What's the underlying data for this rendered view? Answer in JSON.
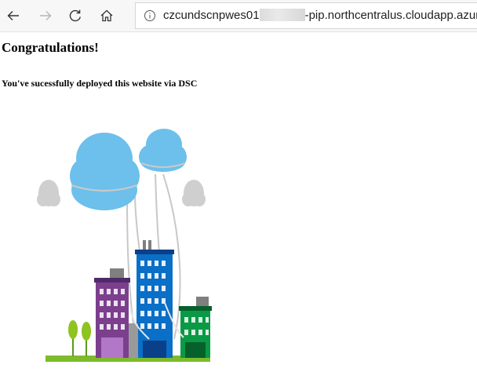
{
  "browser": {
    "back_icon": "arrow-left-icon",
    "forward_icon": "arrow-right-icon",
    "refresh_icon": "refresh-icon",
    "home_icon": "home-icon",
    "info_icon": "info-circle-icon",
    "url_prefix": "czcundscnpwes01",
    "url_suffix": "-pip.northcentralus.cloudapp.azure.com/"
  },
  "page": {
    "heading": "Congratulations!",
    "message": "You've sucessfully deployed this website via DSC",
    "illustration": "city-buildings-clouds-illustration"
  },
  "colors": {
    "cloud_blue": "#6cc0eb",
    "building_purple": "#7b3f8e",
    "building_blue": "#0a6fc7",
    "building_green": "#0a9a45",
    "grass_green": "#7dbb2c"
  }
}
